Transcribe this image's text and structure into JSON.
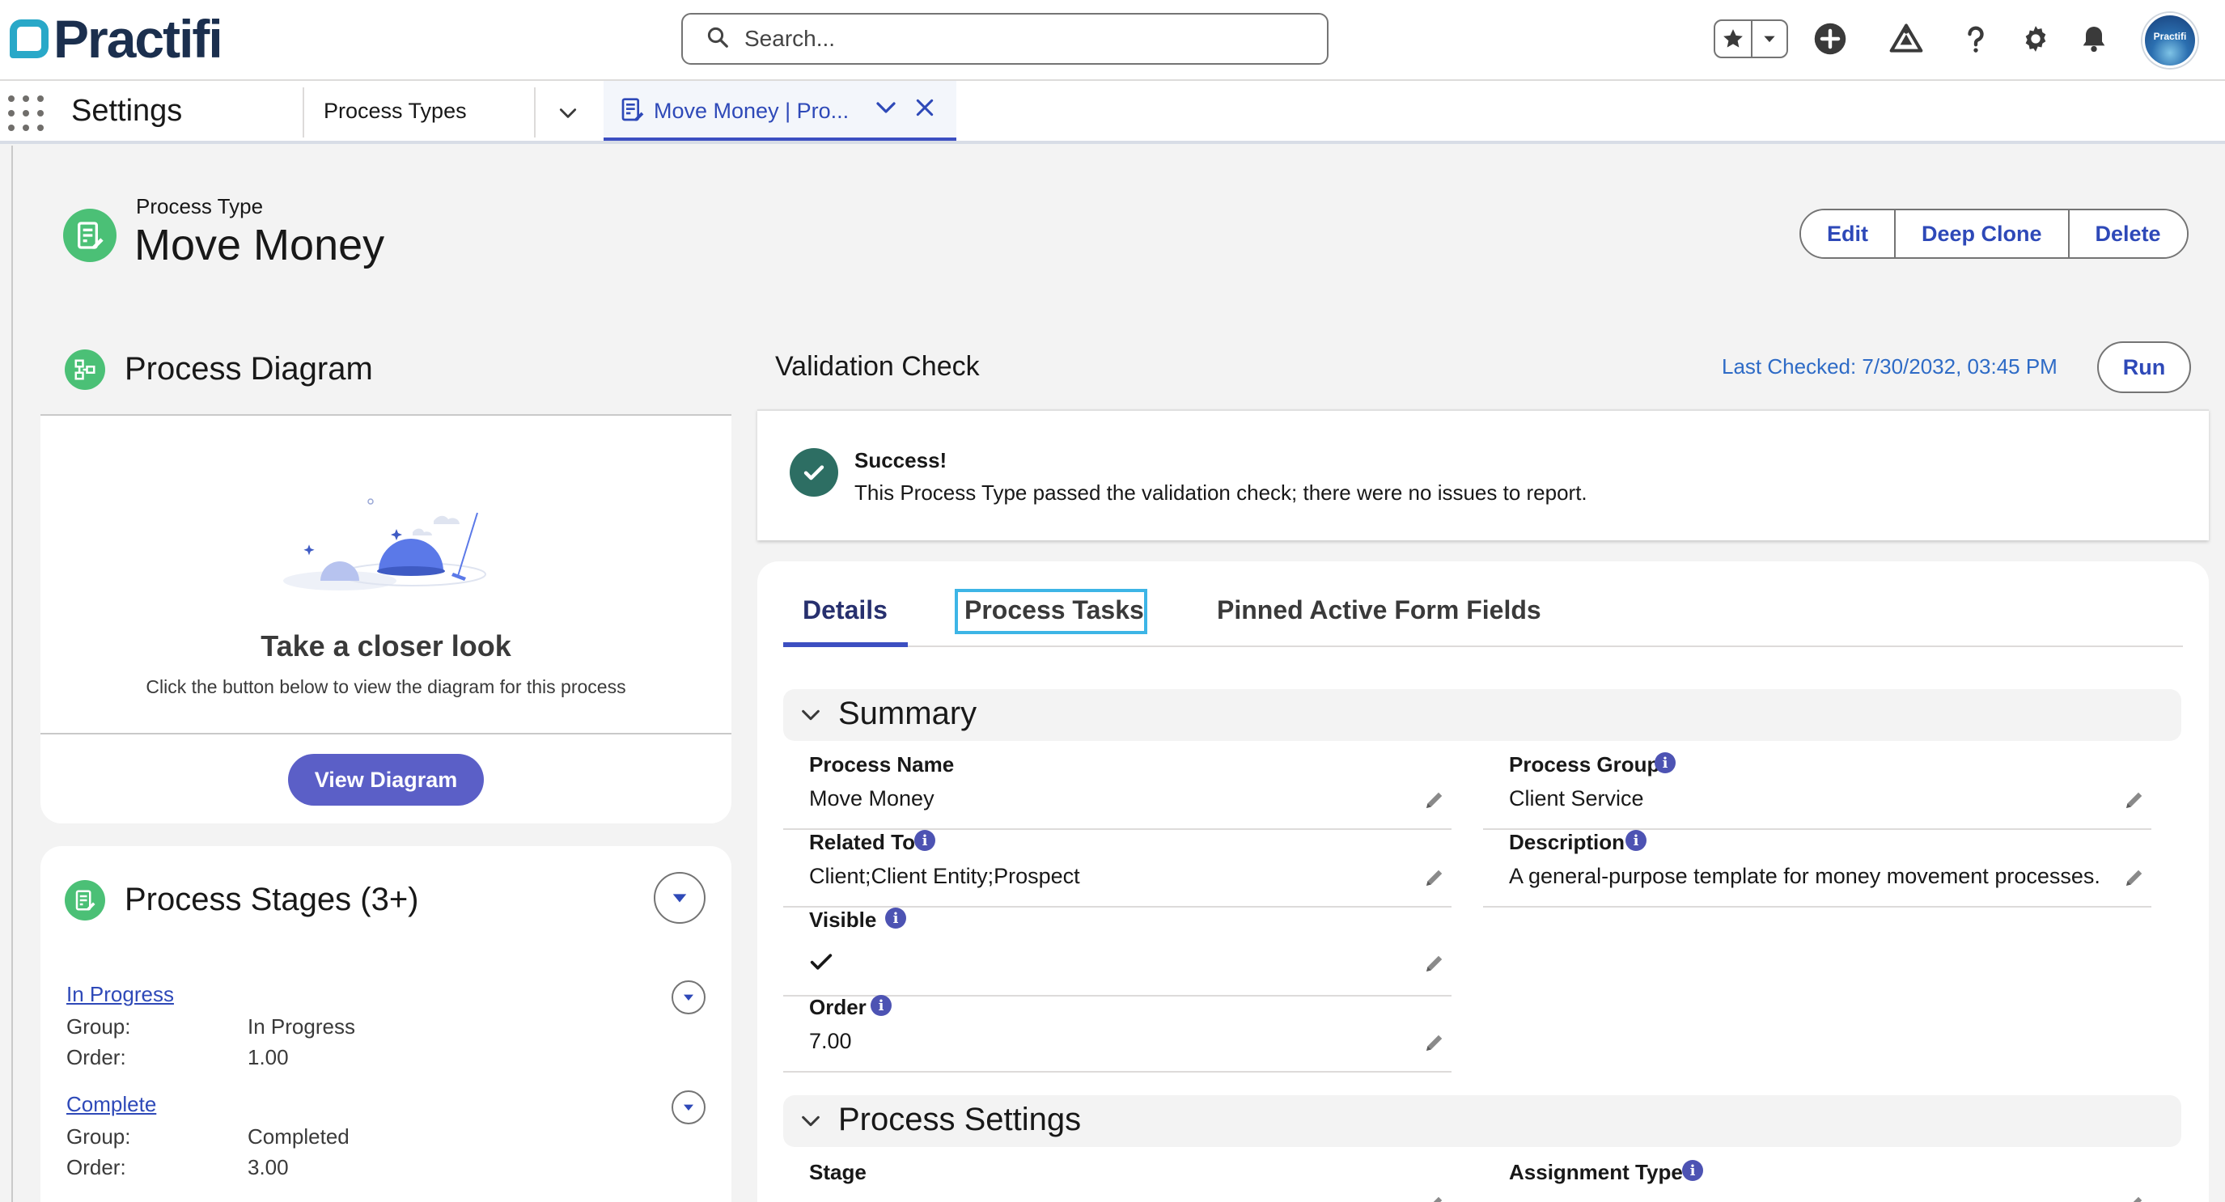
{
  "brand": {
    "name": "Practifi",
    "accent": "#29a8c8",
    "primary": "#2e49b8"
  },
  "header": {
    "search_placeholder": "Search...",
    "icons": [
      "favorites-star-icon",
      "add-icon",
      "trailhead-icon",
      "help-icon",
      "setup-gear-icon",
      "notifications-bell-icon"
    ],
    "avatar_text": "Practifi"
  },
  "nav": {
    "app_name": "Settings",
    "tab_process_types": "Process Types",
    "active_tab": "Move Money | Pro..."
  },
  "record": {
    "type_label": "Process Type",
    "title": "Move Money",
    "actions": [
      "Edit",
      "Deep Clone",
      "Delete"
    ]
  },
  "diagram": {
    "title": "Process Diagram",
    "closer_title": "Take a closer look",
    "closer_sub": "Click the button below to view the diagram for this process",
    "button": "View Diagram"
  },
  "stages": {
    "title": "Process Stages (3+)",
    "group_label": "Group:",
    "order_label": "Order:",
    "items": [
      {
        "name": "In Progress",
        "group": "In Progress",
        "order": "1.00"
      },
      {
        "name": "Complete",
        "group": "Completed",
        "order": "3.00"
      }
    ]
  },
  "validation": {
    "title": "Validation Check",
    "last_checked": "Last Checked: 7/30/2032, 03:45 PM",
    "run": "Run",
    "status_title": "Success!",
    "status_message": "This Process Type passed the validation check; there were no issues to report."
  },
  "tabs": [
    "Details",
    "Process Tasks",
    "Pinned Active Form Fields"
  ],
  "summary": {
    "title": "Summary",
    "fields": {
      "process_name": {
        "label": "Process Name",
        "value": "Move Money"
      },
      "process_group": {
        "label": "Process Group",
        "value": "Client Service"
      },
      "related_to": {
        "label": "Related To",
        "value": "Client;Client Entity;Prospect"
      },
      "description": {
        "label": "Description",
        "value": "A general-purpose template for money movement processes."
      },
      "visible": {
        "label": "Visible",
        "value": true
      },
      "order": {
        "label": "Order",
        "value": "7.00"
      }
    }
  },
  "process_settings": {
    "title": "Process Settings",
    "stage_label": "Stage",
    "assignment_type_label": "Assignment Type"
  }
}
